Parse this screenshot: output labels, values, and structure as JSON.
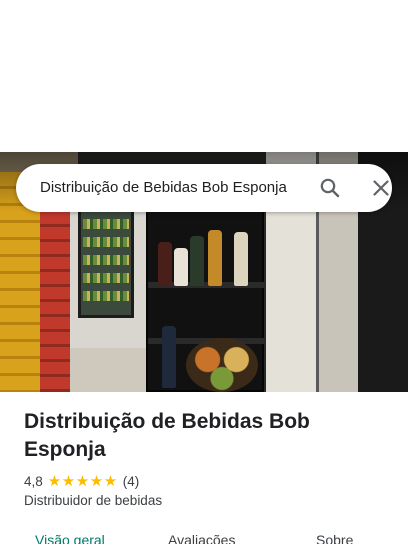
{
  "search": {
    "query": "Distribuição de Bebidas Bob Esponja",
    "search_icon": "search-icon",
    "close_icon": "close-icon"
  },
  "hero": {
    "description_icon": "storefront-photo"
  },
  "place": {
    "name": "Distribuição de Bebidas Bob Esponja",
    "rating": "4,8",
    "stars": 5,
    "review_count": "(4)",
    "category": "Distribuidor de bebidas"
  },
  "tabs": [
    {
      "label": "Visão geral",
      "active": true
    },
    {
      "label": "Avaliações",
      "active": false
    },
    {
      "label": "Sobre",
      "active": false
    }
  ],
  "colors": {
    "accent": "#00796b",
    "star": "#fbbc04",
    "text": "#202124",
    "secondary_text": "#3c4043"
  }
}
